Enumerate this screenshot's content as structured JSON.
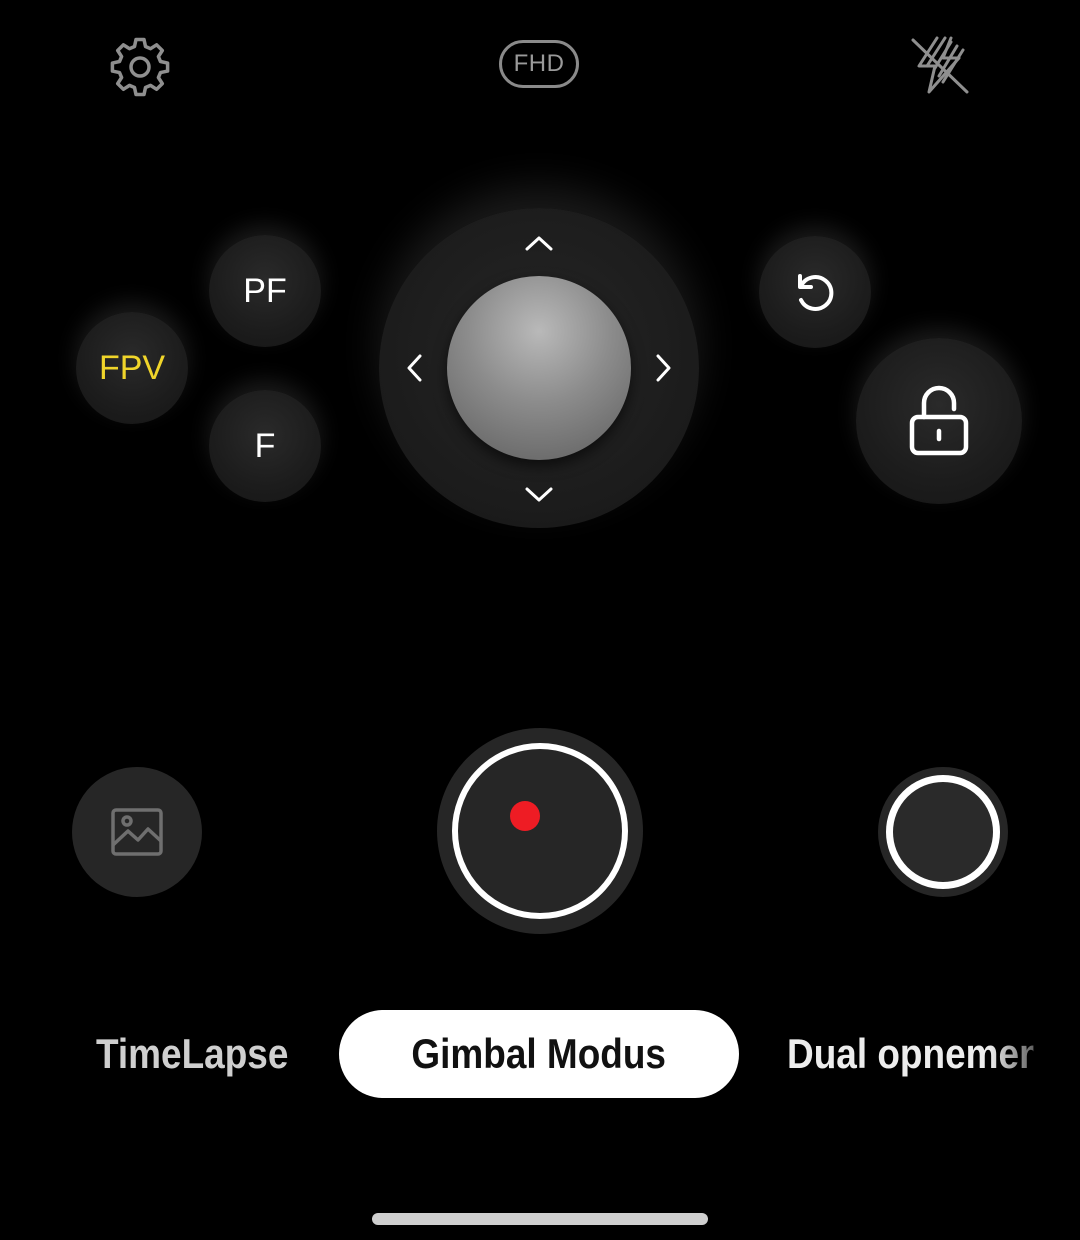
{
  "top_bar": {
    "settings_icon": "gear-icon",
    "resolution_label": "FHD",
    "flash_icon": "flash-off-icon"
  },
  "gimbal_modes": {
    "pf_label": "PF",
    "fpv_label": "FPV",
    "f_label": "F",
    "active_mode": "FPV",
    "active_color": "#f0d52a"
  },
  "joystick": {
    "up_icon": "chevron-up-icon",
    "down_icon": "chevron-down-icon",
    "left_icon": "chevron-left-icon",
    "right_icon": "chevron-right-icon"
  },
  "side_controls": {
    "reset_icon": "rotate-reset-icon",
    "lock_icon": "unlock-icon"
  },
  "bottom_controls": {
    "gallery_icon": "image-icon",
    "record_color": "#ee1c24",
    "photo_icon": "shutter-icon"
  },
  "mode_bar": {
    "modes": [
      "TimeLapse",
      "Gimbal Modus",
      "Dual opnemen"
    ],
    "selected": "Gimbal Modus"
  }
}
